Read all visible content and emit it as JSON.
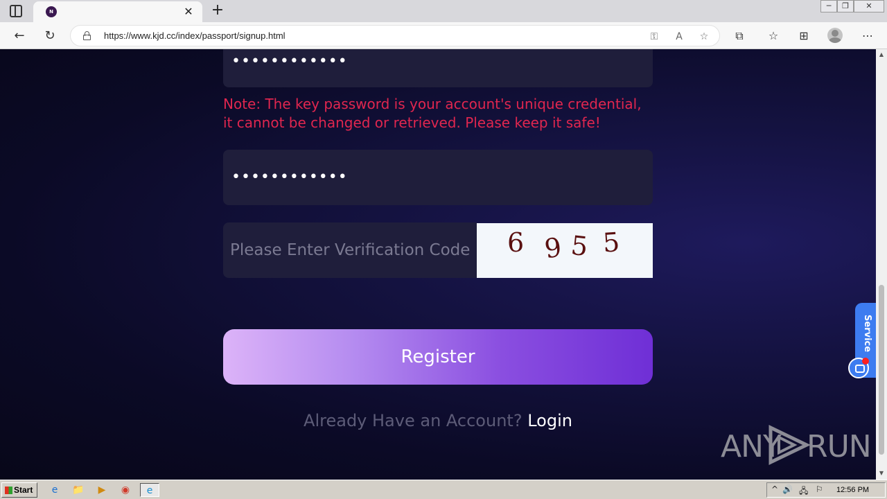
{
  "browser": {
    "tab": {
      "favicon_letter": "N",
      "close_glyph": "✕"
    },
    "new_tab_glyph": "+",
    "window_controls": [
      "─",
      "❐",
      "✕"
    ],
    "address_bar": {
      "url": "https://www.kjd.cc/index/passport/signup.html"
    },
    "nav": {
      "back_glyph": "←",
      "reload_glyph": "↻"
    },
    "address_icons": [
      "⚿",
      "A",
      "☆"
    ],
    "toolbar_icons": [
      "⧉",
      "☆",
      "⊞",
      "⋯"
    ]
  },
  "page": {
    "password_value": "••••••••••••",
    "note": "Note: The key password is your account's unique credential, it cannot be changed or retrieved. Please keep it safe!",
    "confirm_password_value": "••••••••••••",
    "captcha_placeholder": "Please Enter Verification Code",
    "captcha_digits": [
      "6",
      "9",
      "5",
      "5"
    ],
    "register_label": "Register",
    "login_prompt": "Already Have an Account?",
    "login_link": "Login",
    "service_label": "Service",
    "watermark_left": "ANY",
    "watermark_right": "RUN"
  },
  "taskbar": {
    "start_label": "Start",
    "apps": [
      "e",
      "📁",
      "▶",
      "◉",
      "e"
    ],
    "tray_icons": [
      "^",
      "🔊",
      "🖧",
      "⚐"
    ],
    "clock": "12:56 PM"
  },
  "colors": {
    "note_red": "#e0264f",
    "register_gradient_start": "#dcb3f8",
    "register_gradient_end": "#6f2fd6",
    "service_blue": "#3d7cf0"
  }
}
